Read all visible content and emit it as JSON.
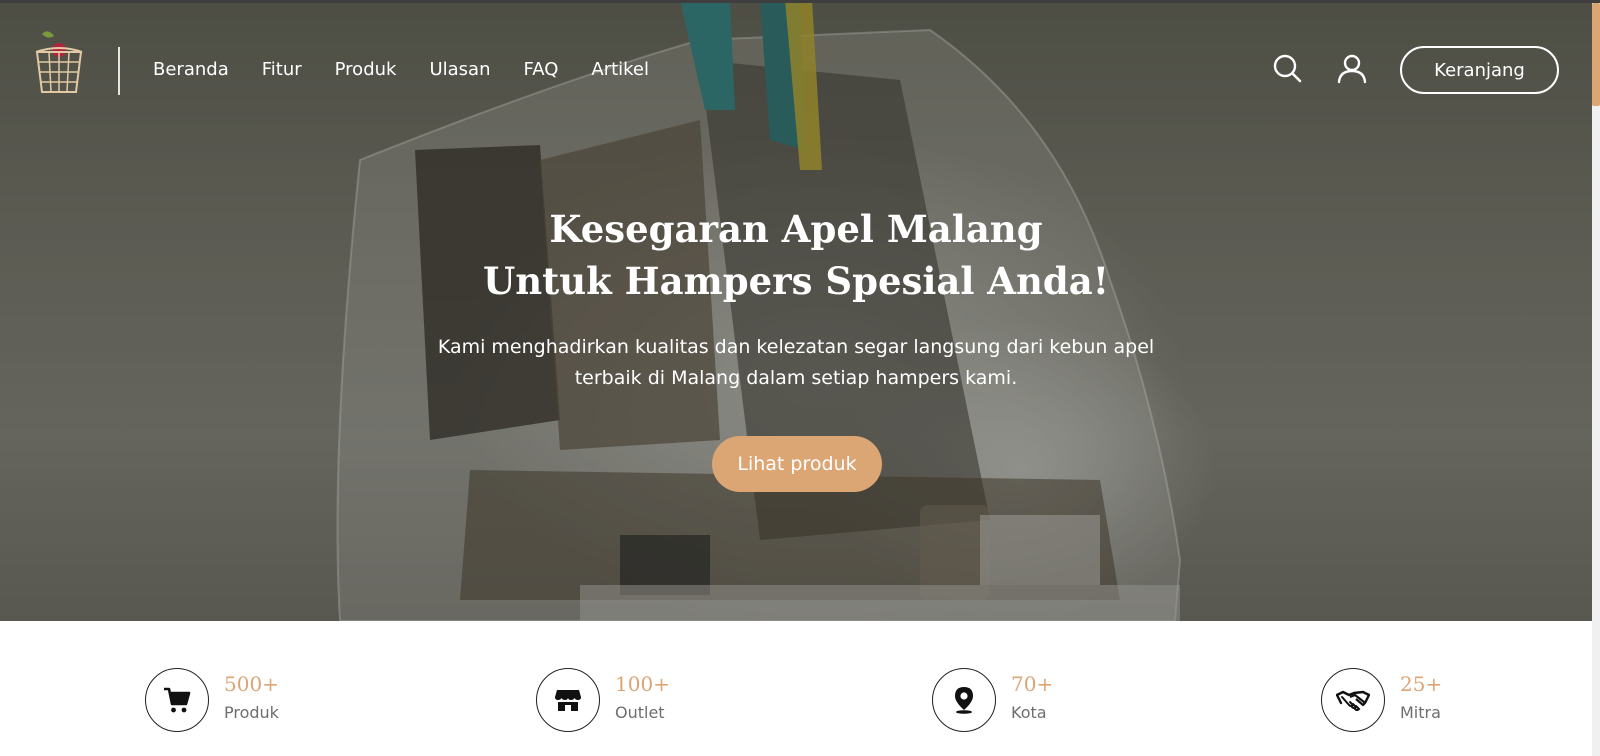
{
  "nav": {
    "items": [
      {
        "label": "Beranda"
      },
      {
        "label": "Fitur"
      },
      {
        "label": "Produk"
      },
      {
        "label": "Ulasan"
      },
      {
        "label": "FAQ"
      },
      {
        "label": "Artikel"
      }
    ],
    "cart_label": "Keranjang",
    "icons": [
      "search-icon",
      "user-icon"
    ]
  },
  "hero": {
    "title_line1": "Kesegaran Apel Malang",
    "title_line2": "Untuk Hampers Spesial Anda!",
    "subtitle_line1": "Kami menghadirkan kualitas dan kelezatan segar langsung dari kebun apel",
    "subtitle_line2": "terbaik di Malang dalam setiap hampers kami.",
    "cta_label": "Lihat produk"
  },
  "stats": [
    {
      "value": "500+",
      "label": "Produk",
      "icon": "cart-icon"
    },
    {
      "value": "100+",
      "label": "Outlet",
      "icon": "store-icon"
    },
    {
      "value": "70+",
      "label": "Kota",
      "icon": "location-pin-icon"
    },
    {
      "value": "25+",
      "label": "Mitra",
      "icon": "handshake-icon"
    }
  ],
  "colors": {
    "accent": "#dba574",
    "hero_overlay": "#5c5d52",
    "text_muted": "#6e6e6e",
    "white": "#ffffff"
  }
}
